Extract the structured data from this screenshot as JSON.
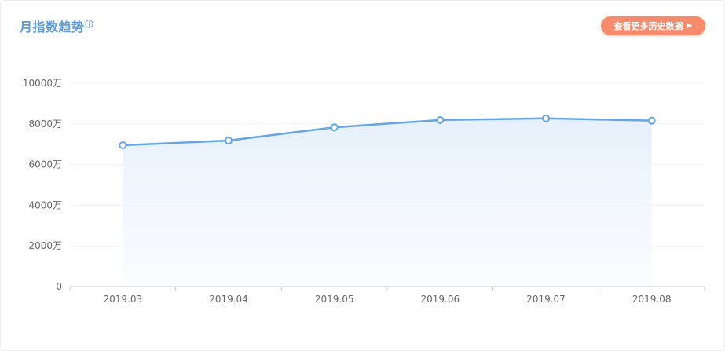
{
  "header": {
    "title": "月指数趋势",
    "info_icon": "info-circle-icon",
    "history_button_label": "查看更多历史数据",
    "history_button_arrow": "▶"
  },
  "colors": {
    "line": "#64a5e8",
    "area_top": "#e6f0fb",
    "button": "#f58b6b",
    "title": "#5b9bd9"
  },
  "chart_data": {
    "type": "area",
    "title": "月指数趋势",
    "xlabel": "",
    "ylabel": "",
    "categories": [
      "2019.03",
      "2019.04",
      "2019.05",
      "2019.06",
      "2019.07",
      "2019.08"
    ],
    "values": [
      6950,
      7180,
      7830,
      8190,
      8270,
      8160
    ],
    "unit": "万",
    "ylim": [
      0,
      10000
    ],
    "yticks": [
      0,
      2000,
      4000,
      6000,
      8000,
      10000
    ],
    "ytick_labels": [
      "0",
      "2000万",
      "4000万",
      "6000万",
      "8000万",
      "10000万"
    ],
    "grid": true,
    "legend": "none"
  }
}
